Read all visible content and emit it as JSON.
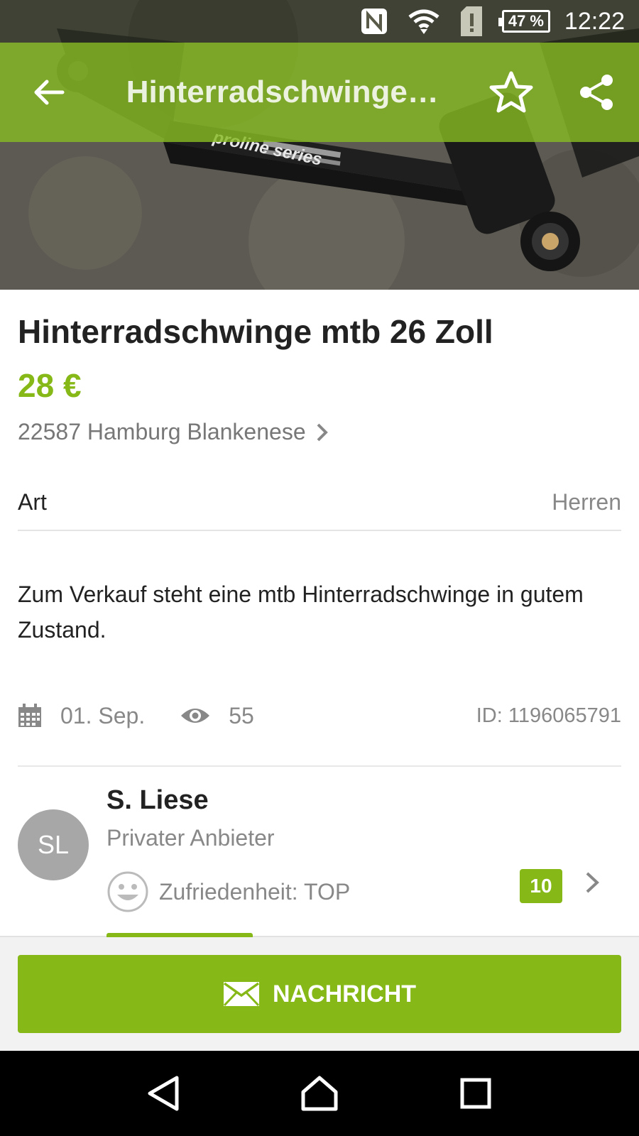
{
  "status_bar": {
    "battery": "47 %",
    "time": "12:22",
    "icons": [
      "nfc-icon",
      "wifi-icon",
      "alert-sim-icon",
      "battery-icon"
    ]
  },
  "app_bar": {
    "title": "Hinterradschwinge…",
    "icons": [
      "back-arrow-icon",
      "star-outline-icon",
      "share-icon"
    ]
  },
  "hero": {
    "photo_text": "proline series"
  },
  "listing": {
    "title": "Hinterradschwinge mtb 26 Zoll",
    "price": "28 €",
    "location": "22587 Hamburg Blankenese",
    "attribute": {
      "label": "Art",
      "value": "Herren"
    },
    "description": "Zum Verkauf steht eine mtb Hinterradschwinge in gutem Zustand.",
    "date": "01. Sep.",
    "views": "55",
    "id": "ID: 1196065791"
  },
  "seller": {
    "initials": "SL",
    "name": "S. Liese",
    "type": "Privater Anbieter",
    "satisfaction": "Zufriedenheit: TOP",
    "rating_count": "10"
  },
  "actions": {
    "message_label": "NACHRICHT"
  },
  "colors": {
    "accent": "#86b817",
    "text_primary": "#222222",
    "text_secondary": "#888888"
  }
}
